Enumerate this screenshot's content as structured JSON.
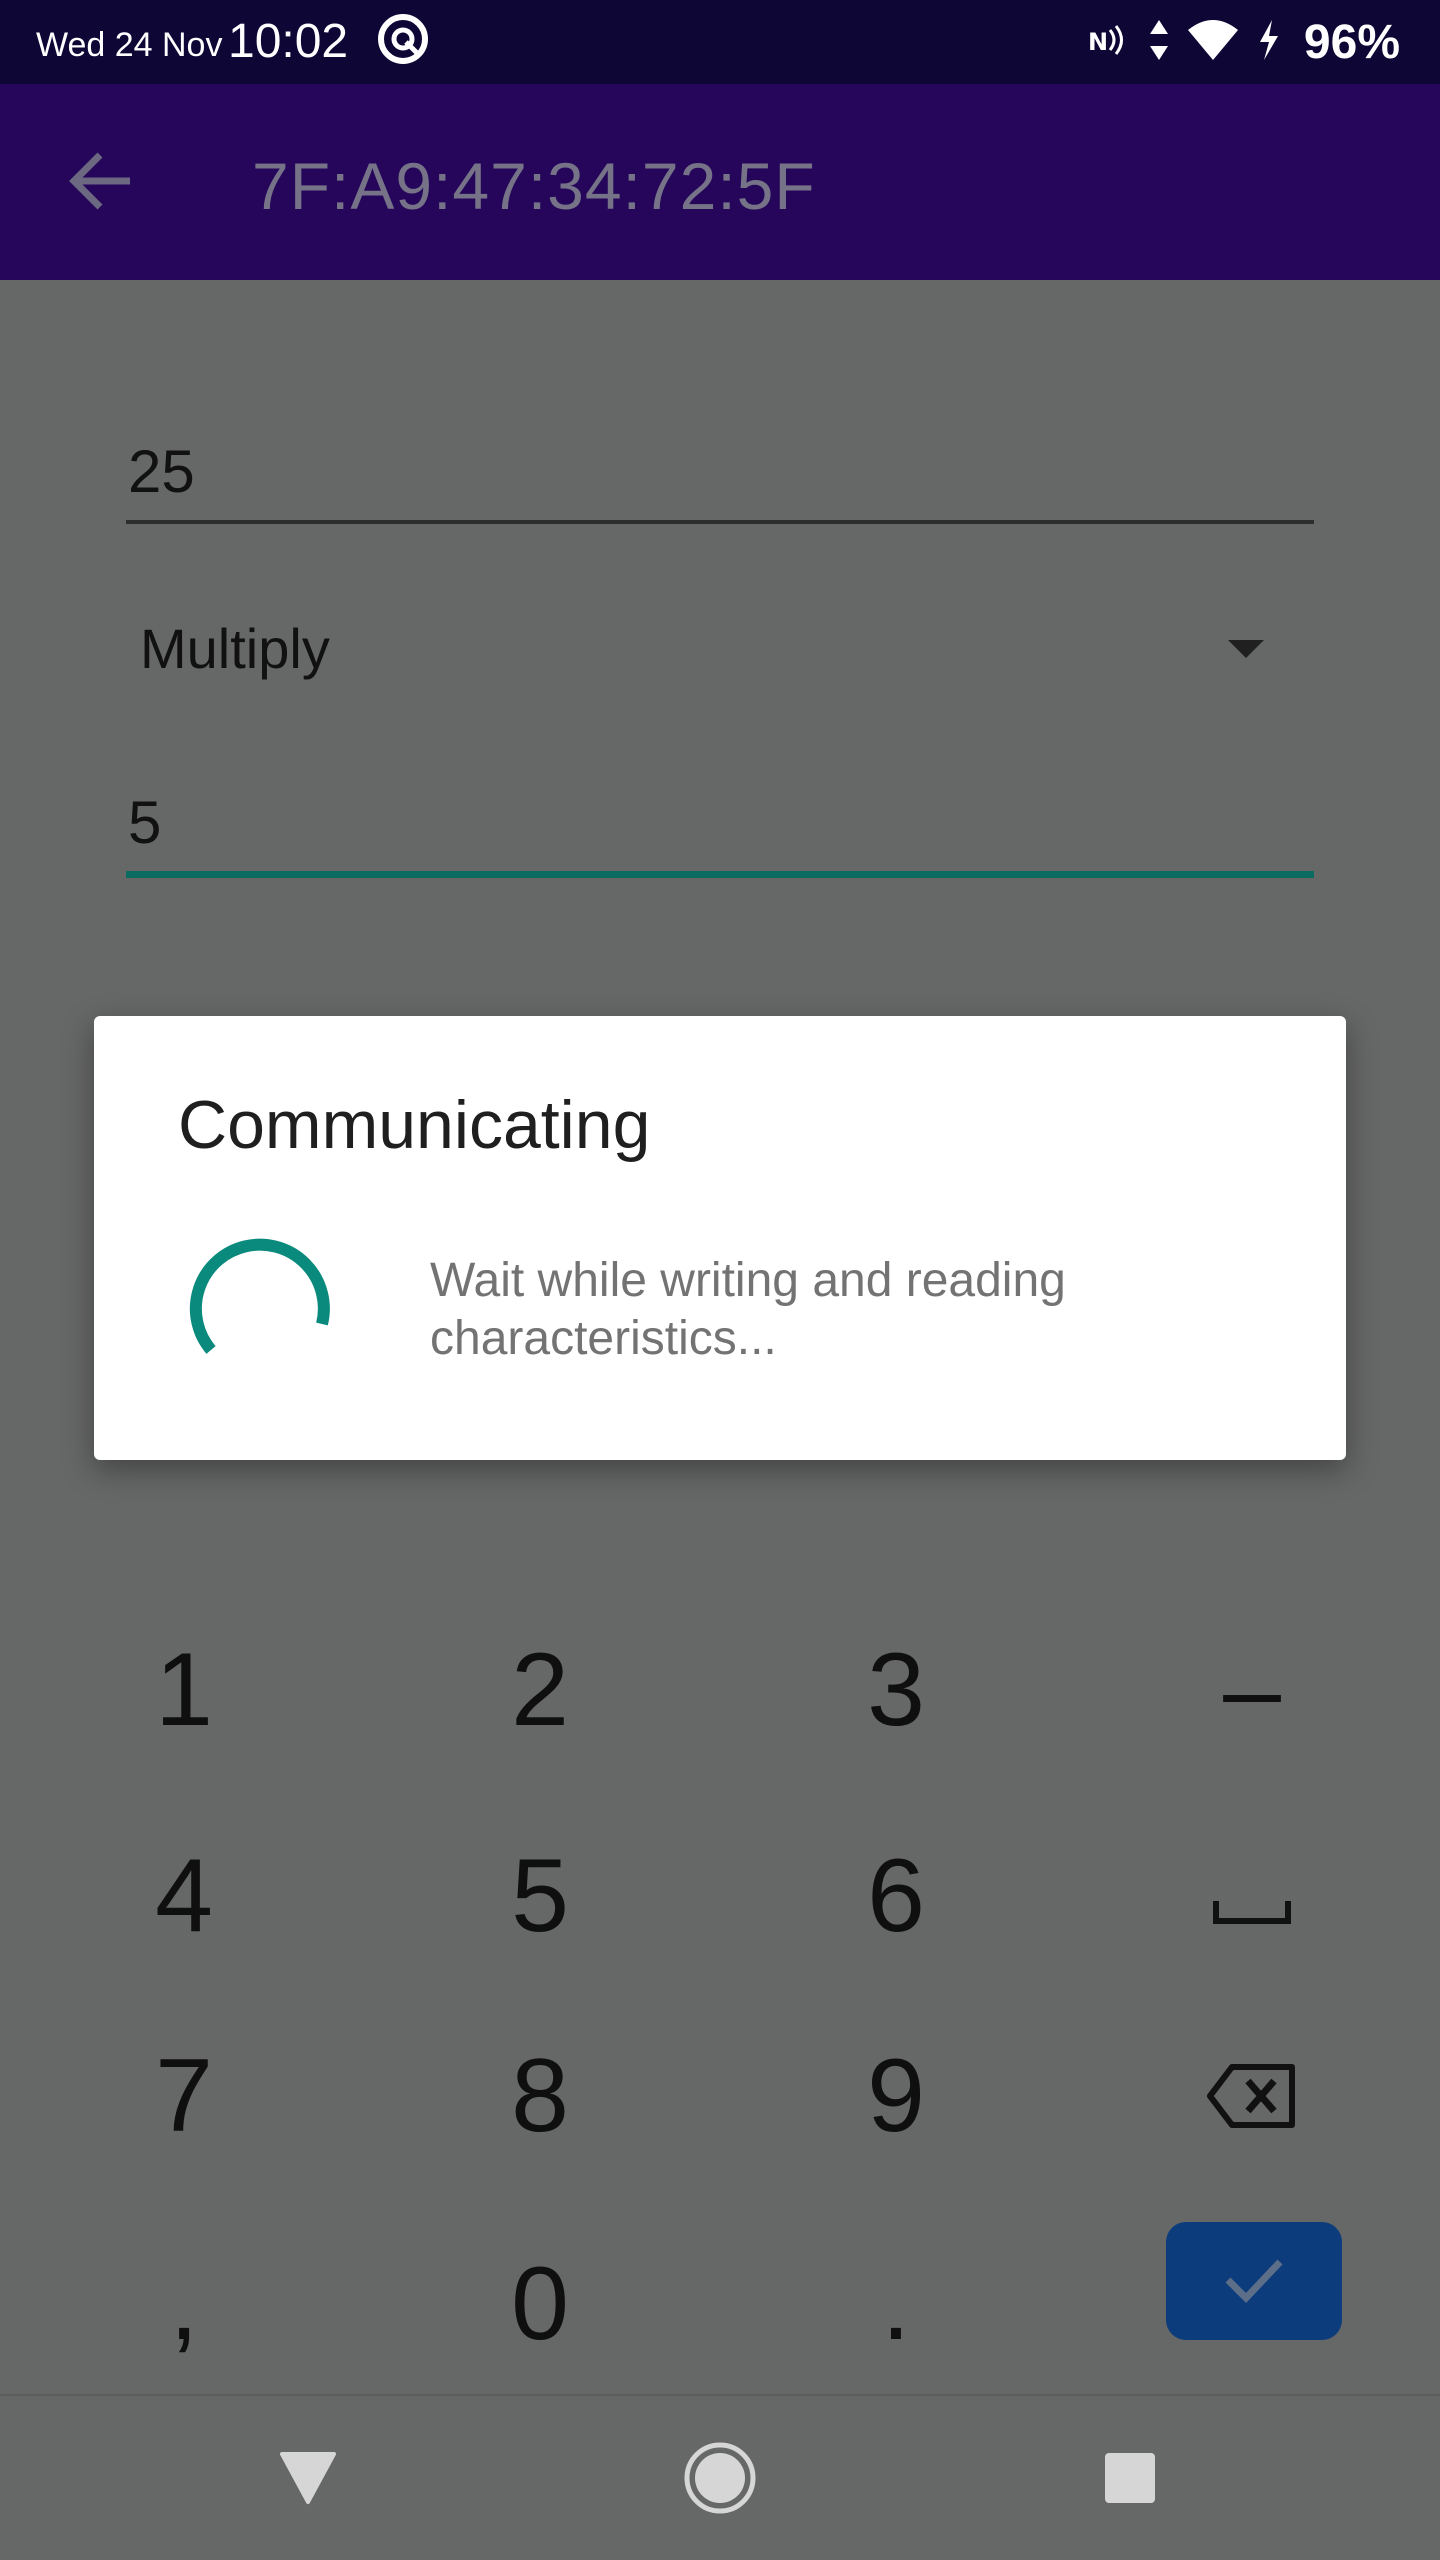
{
  "status_bar": {
    "date": "Wed 24 Nov",
    "time": "10:02",
    "battery": "96%",
    "icons": [
      "at-sign-icon",
      "nfc-icon",
      "data-arrows-icon",
      "wifi-icon",
      "charging-icon"
    ]
  },
  "app_bar": {
    "title": "7F:A9:47:34:72:5F",
    "back_icon": "arrow-back-icon"
  },
  "form": {
    "first_value": "25",
    "operation": "Multiply",
    "second_value": "5"
  },
  "dialog": {
    "title": "Communicating",
    "message": "Wait while writing and reading characteristics...",
    "accent": "#0a8a7c"
  },
  "keypad": {
    "rows": [
      [
        "1",
        "2",
        "3",
        "–"
      ],
      [
        "4",
        "5",
        "6",
        "space-icon"
      ],
      [
        "7",
        "8",
        "9",
        "backspace-icon"
      ],
      [
        ",",
        "0",
        ".",
        "check-icon"
      ]
    ],
    "done_color": "#0d3c7d"
  },
  "nav_bar": {
    "icons": [
      "nav-back-icon",
      "nav-home-icon",
      "nav-recents-icon"
    ]
  },
  "colors": {
    "status_bar": "#0e0635",
    "app_bar": "#25065b",
    "scrim_background": "#666767",
    "active_underline": "#0a6b61"
  }
}
